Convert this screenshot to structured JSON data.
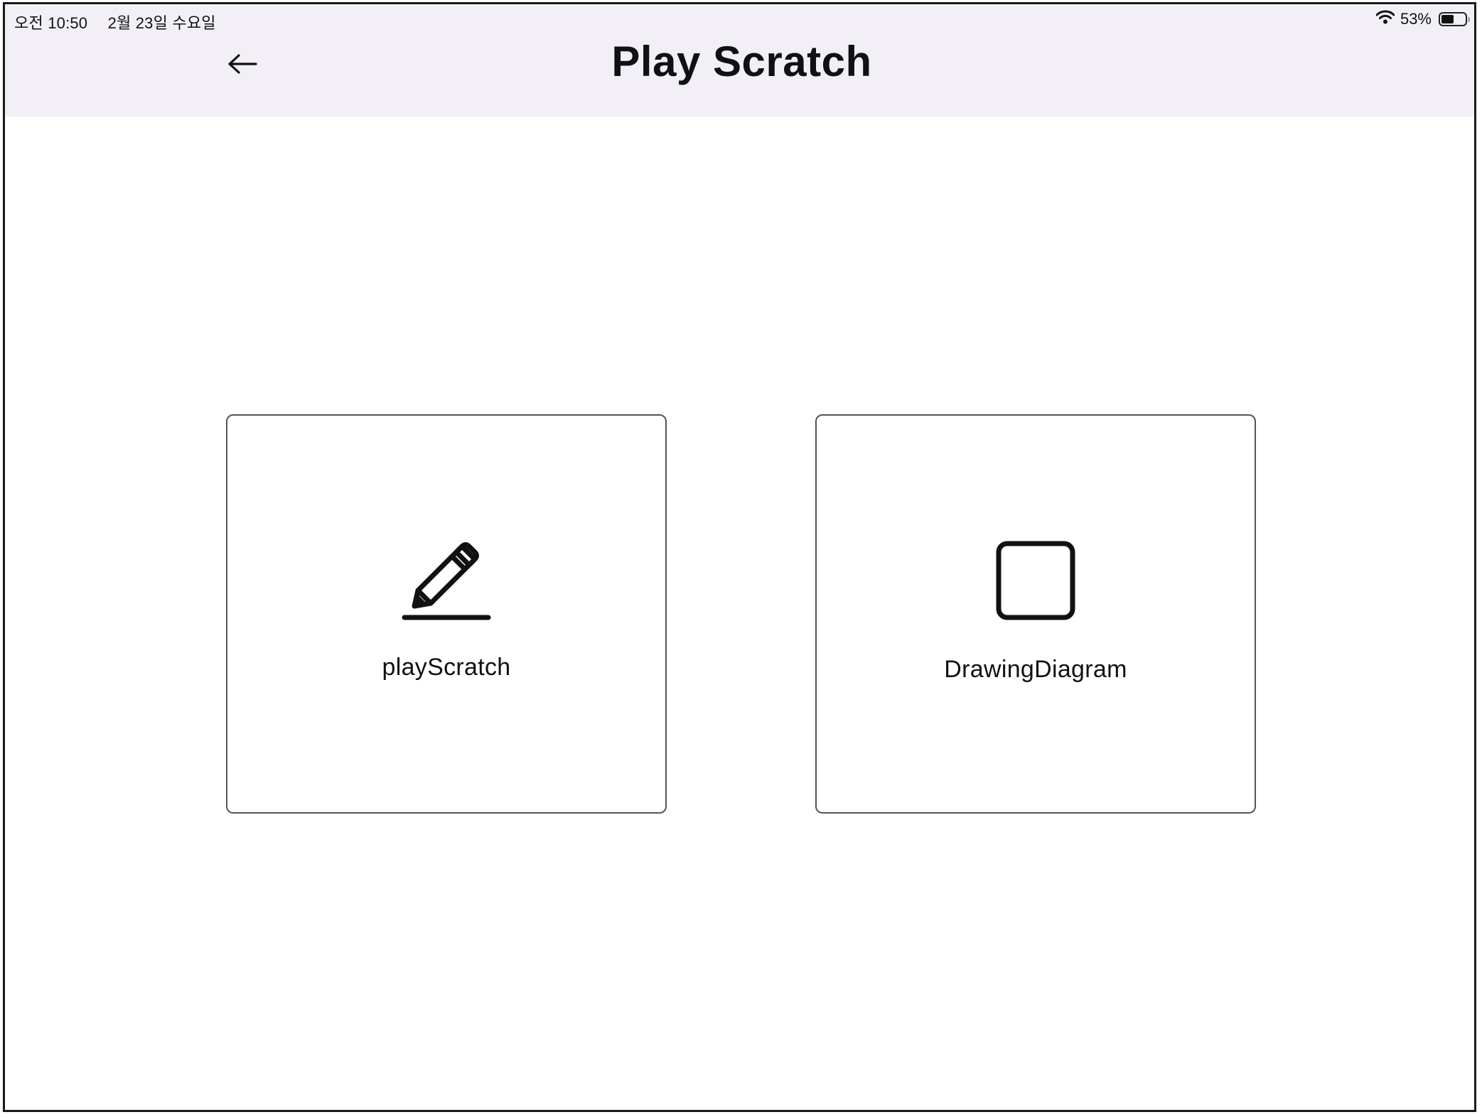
{
  "status_bar": {
    "time": "오전 10:50",
    "date": "2월 23일 수요일",
    "battery_percent_text": "53%",
    "battery_level": 0.53,
    "icons": [
      "wifi-icon",
      "battery-icon"
    ]
  },
  "header": {
    "title": "Play Scratch",
    "back_icon": "arrow-left-icon",
    "background_color": "#f2f0f6"
  },
  "cards": [
    {
      "label": "playScratch",
      "icon": "pencil-icon"
    },
    {
      "label": "DrawingDiagram",
      "icon": "square-icon"
    }
  ]
}
